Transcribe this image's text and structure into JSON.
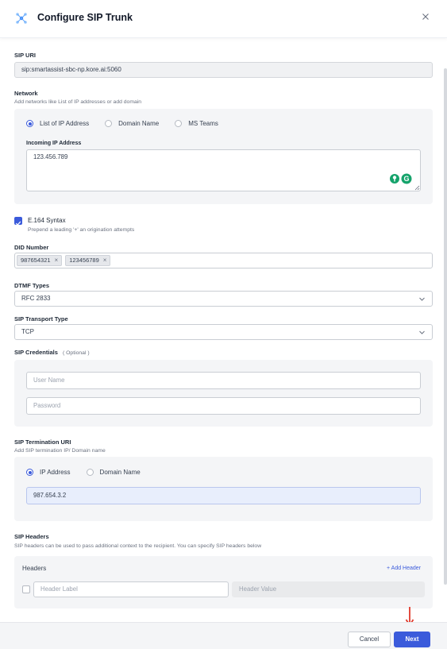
{
  "dialog": {
    "title": "Configure SIP Trunk"
  },
  "sip_uri": {
    "label": "SIP URI",
    "value": "sip:smartassist-sbc-np.kore.ai:5060"
  },
  "network": {
    "label": "Network",
    "hint": "Add networks like List of IP addresses or add domain",
    "options": [
      "List of IP Address",
      "Domain Name",
      "MS Teams"
    ],
    "selected": "List of IP Address",
    "incoming_label": "Incoming IP Address",
    "incoming_value": "123.456.789"
  },
  "e164": {
    "label": "E.164 Syntax",
    "hint": "Prepend a leading '+' an origination attempts",
    "checked": true
  },
  "did": {
    "label": "DID Number",
    "chips": [
      "987654321",
      "123456789"
    ],
    "remove_glyph": "×"
  },
  "dtmf": {
    "label": "DTMF Types",
    "value": "RFC 2833"
  },
  "transport": {
    "label": "SIP Transport Type",
    "value": "TCP"
  },
  "credentials": {
    "label": "SIP Credentials",
    "optional": "( Optional )",
    "username_placeholder": "User Name",
    "password_placeholder": "Password"
  },
  "termination": {
    "label": "SIP Termination URI",
    "hint": "Add SIP termination IP/ Domain name",
    "options": [
      "IP Address",
      "Domain Name"
    ],
    "selected": "IP Address",
    "value": "987.654.3.2"
  },
  "headers": {
    "label": "SIP Headers",
    "hint": "SIP headers can be used to pass additional context to the recipient. You can specify SIP headers below",
    "panel_title": "Headers",
    "add_label": "+ Add Header",
    "label_placeholder": "Header Label",
    "value_placeholder": "Header Value"
  },
  "footer": {
    "cancel_label": "Cancel",
    "next_label": "Next"
  },
  "colors": {
    "accent": "#3b5bdb",
    "arrow": "#e0392b",
    "grammarly_green": "#15a36b"
  }
}
